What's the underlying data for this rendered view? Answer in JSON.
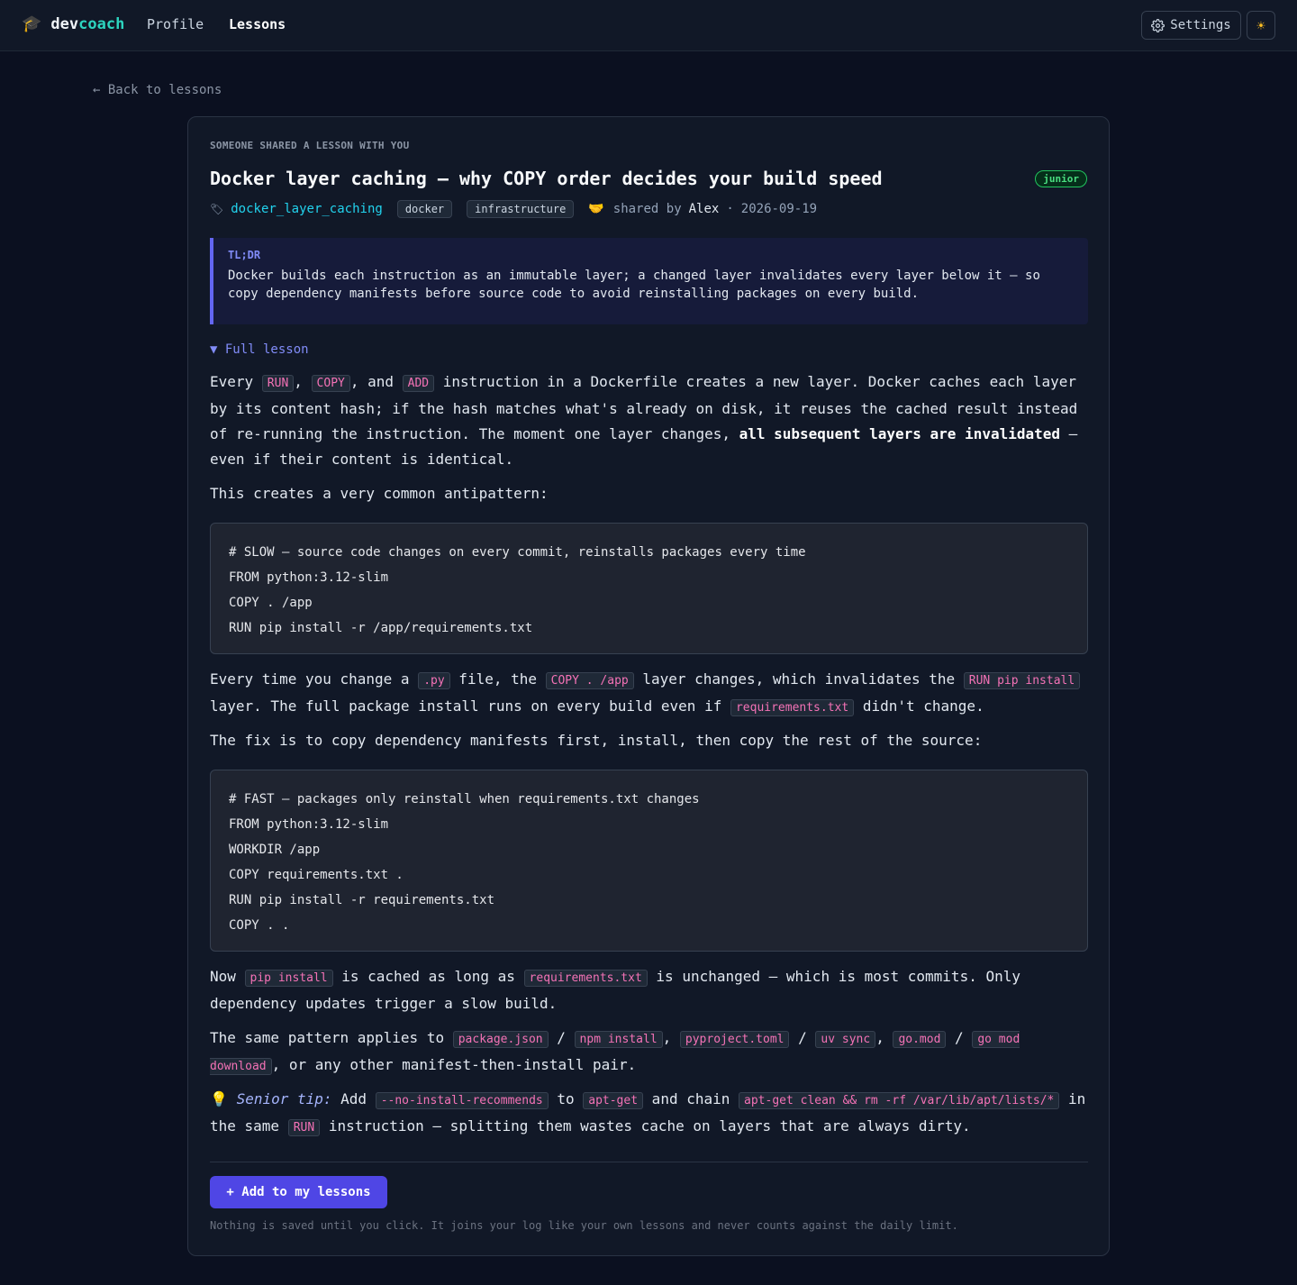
{
  "nav": {
    "brand_icon": "🎓",
    "brand_part1": "dev",
    "brand_part2": "coach",
    "profile": "Profile",
    "lessons": "Lessons",
    "settings": "Settings",
    "theme_icon": "☀"
  },
  "back": "← Back to lessons",
  "lesson": {
    "eyebrow": "SOMEONE SHARED A LESSON WITH YOU",
    "title": "Docker layer caching — why COPY order decides your build speed",
    "level": "junior",
    "slug_icon": "🏷",
    "slug": "docker_layer_caching",
    "tags": [
      "docker",
      "infrastructure"
    ],
    "share_icon": "🤝",
    "shared_by_label": "shared by",
    "author": "Alex",
    "date": "2026-09-19",
    "tldr_label": "TL;DR",
    "tldr": "Docker builds each instruction as an immutable layer; a changed layer invalidates every layer below it — so copy dependency manifests before source code to avoid reinstalling packages on every build.",
    "toggle": "▼ Full lesson",
    "p1": {
      "t1": "Every ",
      "c1": "RUN",
      "t2": ", ",
      "c2": "COPY",
      "t3": ", and ",
      "c3": "ADD",
      "t4": " instruction in a Dockerfile creates a new layer. Docker caches each layer by its content hash; if the hash matches what's already on disk, it reuses the cached result instead of re-running the instruction. The moment one layer changes, ",
      "strong": "all subsequent layers are invalidated",
      "t5": " — even if their content is identical."
    },
    "p2": "This creates a very common antipattern:",
    "code1": [
      "# SLOW — source code changes on every commit, reinstalls packages every time",
      "FROM python:3.12-slim",
      "COPY . /app",
      "RUN pip install -r /app/requirements.txt"
    ],
    "p3": {
      "t1": "Every time you change a ",
      "c1": ".py",
      "t2": " file, the ",
      "c2": "COPY . /app",
      "t3": " layer changes, which invalidates the ",
      "c3": "RUN pip install",
      "t4": " layer. The full package install runs on every build even if ",
      "c4": "requirements.txt",
      "t5": " didn't change."
    },
    "p4": "The fix is to copy dependency manifests first, install, then copy the rest of the source:",
    "code2": [
      "# FAST — packages only reinstall when requirements.txt changes",
      "FROM python:3.12-slim",
      "WORKDIR /app",
      "COPY requirements.txt .",
      "RUN pip install -r requirements.txt",
      "COPY . ."
    ],
    "p5": {
      "t1": "Now ",
      "c1": "pip install",
      "t2": " is cached as long as ",
      "c2": "requirements.txt",
      "t3": " is unchanged — which is most commits. Only dependency updates trigger a slow build."
    },
    "p6": {
      "t1": "The same pattern applies to ",
      "c1": "package.json",
      "t2": " / ",
      "c2": "npm install",
      "t3": ", ",
      "c3": "pyproject.toml",
      "t4": " / ",
      "c4": "uv sync",
      "t5": ", ",
      "c5": "go.mod",
      "t6": " / ",
      "c6": "go mod download",
      "t7": ", or any other manifest-then-install pair."
    },
    "p7": {
      "icon": "💡",
      "em": "Senior tip:",
      "t1": " Add ",
      "c1": "--no-install-recommends",
      "t2": " to ",
      "c2": "apt-get",
      "t3": " and chain ",
      "c3": "apt-get clean && rm -rf /var/lib/apt/lists/*",
      "t4": " in the same ",
      "c4": "RUN",
      "t5": " instruction — splitting them wastes cache on layers that are always dirty."
    },
    "add_button": "+ Add to my lessons",
    "footnote": "Nothing is saved until you click. It joins your log like your own lessons and never counts against the daily limit."
  },
  "colors": {
    "background": "#0b1020",
    "card": "#111827",
    "accent": "#4f46e5",
    "brand_teal": "#2dd4bf",
    "inline_code": "#f472b6",
    "level_green": "#4ade80"
  }
}
